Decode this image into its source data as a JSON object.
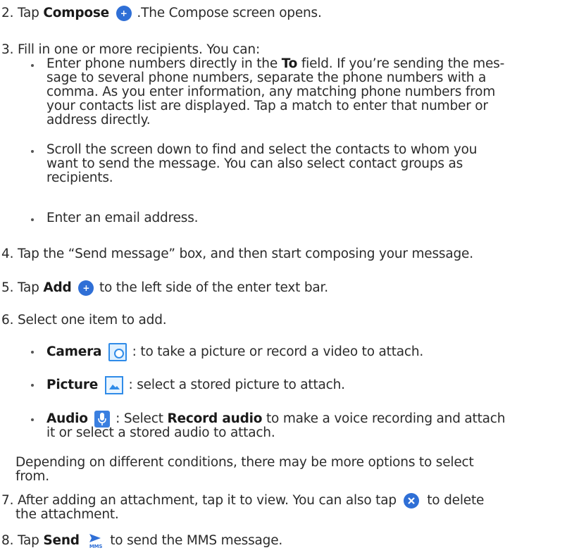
{
  "steps": {
    "s2": {
      "num": "2.",
      "pre": "Tap",
      "bold": "Compose",
      "post": ".The Compose screen opens."
    },
    "s3": {
      "num": "3.",
      "intro": "Fill in one or more recipients. You can:",
      "b1_l1_pre": "Enter phone numbers directly in the",
      "b1_l1_bold": "To",
      "b1_l1_post": "field. If you’re sending the mes-",
      "b1_l2": "sage to several phone numbers, separate the phone numbers with a",
      "b1_l3": "comma. As you enter information, any matching phone numbers from",
      "b1_l4": "your contacts list are displayed. Tap a match to enter that number or",
      "b1_l5": "address directly.",
      "b2_l1": "Scroll the screen down to find and select the contacts to whom you",
      "b2_l2": "want to send the message. You can also select contact groups as",
      "b2_l3": "recipients.",
      "b3": "Enter an email address."
    },
    "s4": {
      "num": "4.",
      "text": "Tap the “Send message” box, and then start composing your message."
    },
    "s5": {
      "num": "5.",
      "pre": "Tap",
      "bold": "Add",
      "post": "to the left side of the enter text bar."
    },
    "s6": {
      "num": "6.",
      "text": "Select one item to add.",
      "cam_bold": "Camera",
      "cam_text": ": to take a picture or record a video to attach.",
      "pic_bold": "Picture",
      "pic_text": ": select a stored picture to attach.",
      "aud_bold": "Audio",
      "aud_mid": ": Select",
      "aud_bold2": "Record audio",
      "aud_text": "to make a voice recording and attach",
      "aud_l2": "it or select a stored audio to attach.",
      "note_l1": "Depending on different conditions, there may be more options to select",
      "note_l2": "from."
    },
    "s7": {
      "num": "7.",
      "l1_pre": "After adding an attachment, tap it to view. You can also tap",
      "l1_post": "to delete",
      "l2": "the attachment."
    },
    "s8": {
      "num": "8.",
      "pre": "Tap",
      "bold": "Send",
      "post": "to send the MMS message."
    }
  },
  "icons": {
    "compose": "plus-circle-icon",
    "add": "plus-circle-icon",
    "camera": "camera-icon",
    "picture": "picture-icon",
    "audio": "microphone-icon",
    "delete": "close-circle-icon",
    "send": "send-mms-icon",
    "send_caption": "MMS",
    "plus_glyph": "+",
    "accent": "#2f6fd6"
  }
}
